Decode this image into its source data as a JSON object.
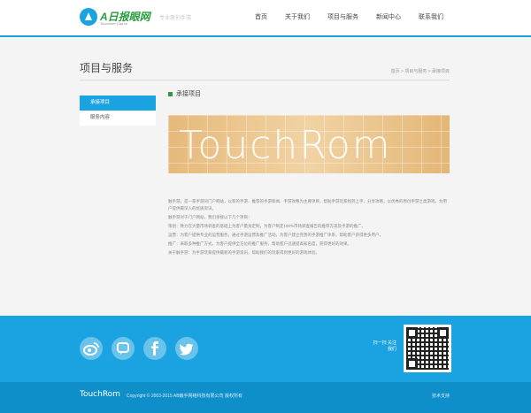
{
  "header": {
    "logo_text": "A日报眼网",
    "logo_sub": "Touchrom·Cay.cn",
    "tagline": "专业原创手游",
    "nav": [
      "首页",
      "关于我们",
      "项目与服务",
      "新闻中心",
      "联系我们"
    ]
  },
  "page": {
    "title": "项目与服务",
    "breadcrumb": "首页 > 项目与服务 > 承接项目"
  },
  "sidebar": {
    "items": [
      {
        "label": "承接项目",
        "active": true
      },
      {
        "label": "服务内容",
        "active": false
      }
    ]
  },
  "content": {
    "section_title": "承接项目",
    "banner_text": "TouchRom",
    "paragraphs": [
      "触手游，是一家手游同门户网站，以新的手游、推荐的手游新闻、手游攻略为主要项目，帮助手游玩家找到上手、分享攻略，以优秀的原创手游之类游戏，为用户提供最深入的优质资讯。",
      "触手游对于门户网站，我们承接以下几个项目：",
      "策划：致力在大量市场调查的基础上为客户量身定制，为客户制定100%市场调查报告的推荐方案及手游的推广。",
      "运营：为客户提供专业的运营服务，通过手游运营及推广活动，为客户建立完善的手游推广体系，帮助客户获得更多用户。",
      "推广：采取多种推广方式，为客户提供全方位的推广服务，帮助客户迅速提高知名度，获得更好的效果。",
      "关于触手游：为手游玩家提供最新的手游资讯，帮助我们的玩家得到更好的游戏体验。"
    ]
  },
  "footer": {
    "social_icons": [
      "weibo-icon",
      "qq-icon",
      "facebook-icon",
      "twitter-icon"
    ],
    "qr_label": "扫一扫 关注我们",
    "brand": "TouchRom",
    "copyright": "Copyright © 2003-2015 AB触手网络科技有限公司 版权所有",
    "tech_support": "技术支持"
  },
  "colors": {
    "accent": "#1aa3e0",
    "footer_dark": "#0e8fca",
    "logo_green": "#2a9b3f",
    "banner": "#e8c08a"
  }
}
